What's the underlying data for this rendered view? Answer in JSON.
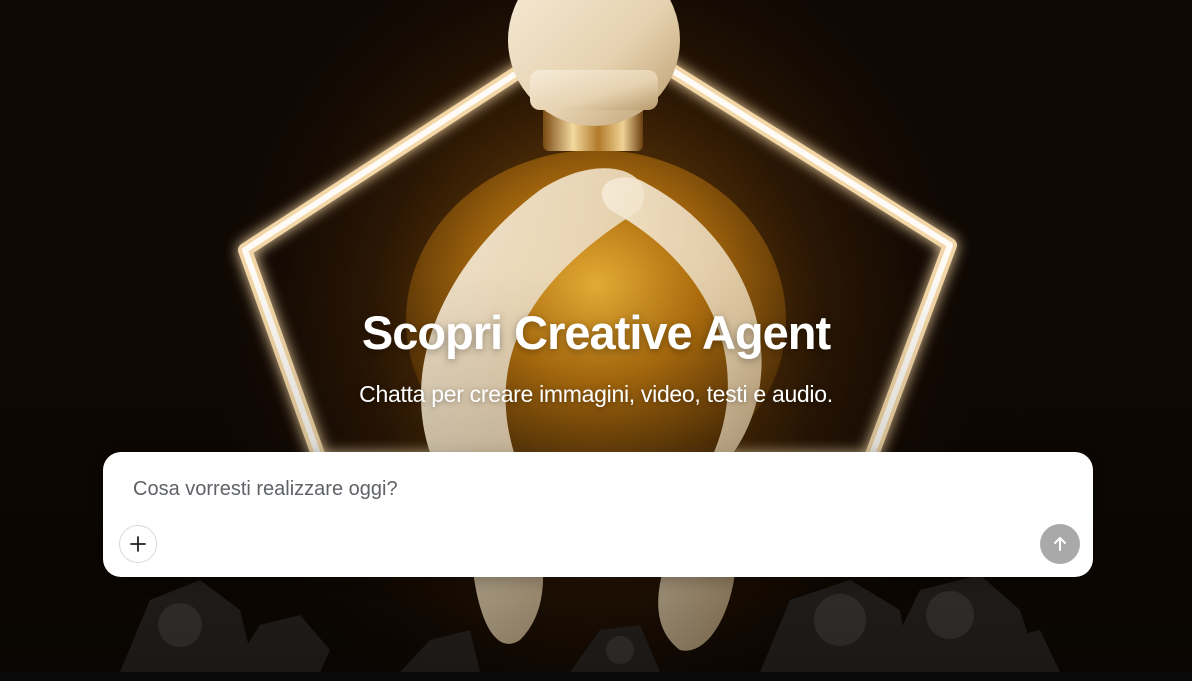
{
  "hero": {
    "title": "Scopri Creative Agent",
    "subtitle": "Chatta per creare immagini, video, testi e audio.",
    "background_image": "perfume-bottle-illustration"
  },
  "composer": {
    "placeholder": "Cosa vorresti realizzare oggi?",
    "value": "",
    "add_icon": "plus-icon",
    "send_icon": "arrow-up-icon"
  },
  "colors": {
    "title_text": "#ffffff",
    "composer_bg": "#ffffff",
    "placeholder_text": "#5f6368",
    "send_button_disabled": "#a9a9a9",
    "background_glow": "#8a5a12"
  }
}
